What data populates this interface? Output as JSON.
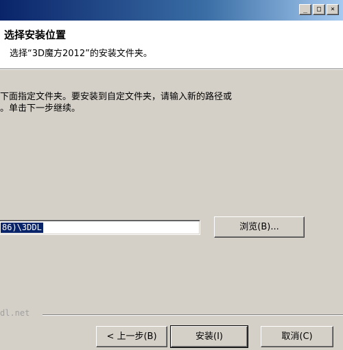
{
  "window": {
    "minimize_glyph": "_",
    "maximize_glyph": "□",
    "close_glyph": "×"
  },
  "header": {
    "title": "选择安装位置",
    "subtitle": "选择“3D魔方2012”的安装文件夹。"
  },
  "description": {
    "line1": "下面指定文件夹。要安装到自定文件夹，请输入新的路径或",
    "line2": "。单击下一步继续。"
  },
  "destination": {
    "path_value": "86)\\3DDL",
    "browse_label": "浏览(B)..."
  },
  "footer": {
    "watermark": "dl.net",
    "back_label": "< 上一步(B)",
    "install_label": "安装(I)",
    "cancel_label": "取消(C)"
  }
}
